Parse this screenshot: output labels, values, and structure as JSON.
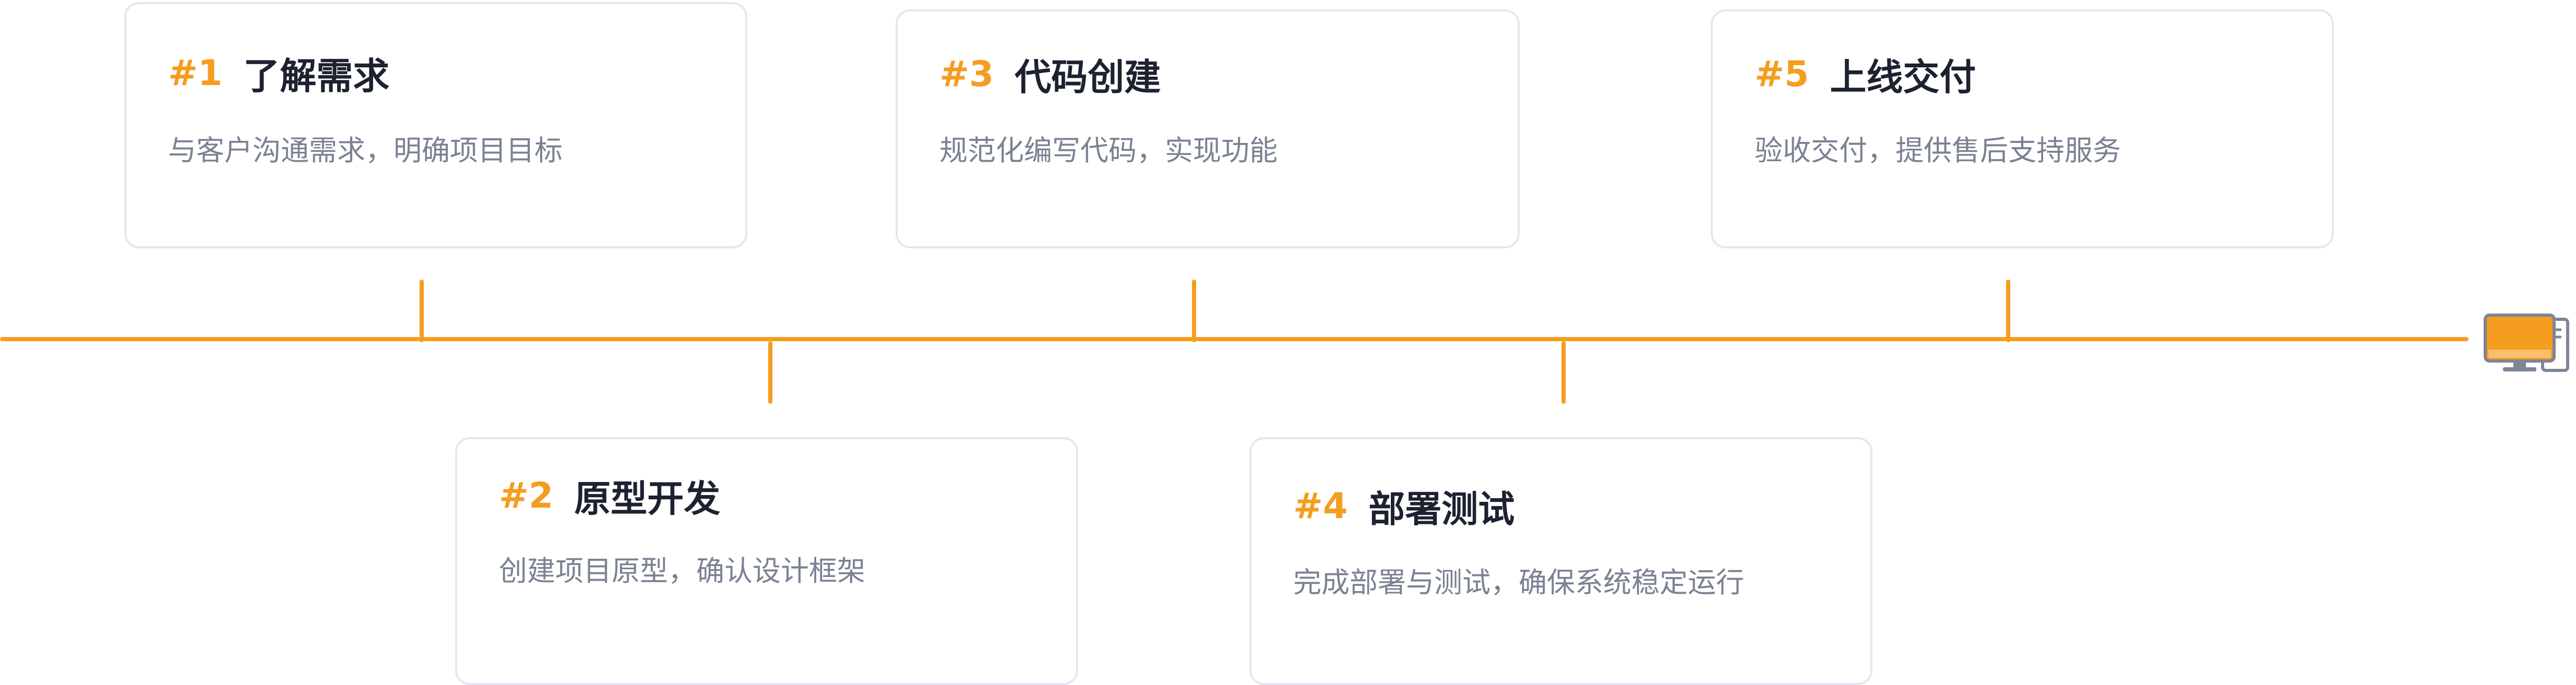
{
  "colors": {
    "accent": "#f59d1f",
    "title": "#1d2230",
    "description": "#7a8292",
    "card_border": "#e6e6f0"
  },
  "steps": [
    {
      "number": "#1",
      "title": "了解需求",
      "description": "与客户沟通需求，明确项目目标",
      "position": "above"
    },
    {
      "number": "#2",
      "title": "原型开发",
      "description": "创建项目原型，确认设计框架",
      "position": "below"
    },
    {
      "number": "#3",
      "title": "代码创建",
      "description": "规范化编写代码，实现功能",
      "position": "above"
    },
    {
      "number": "#4",
      "title": "部署测试",
      "description": "完成部署与测试，确保系统稳定运行",
      "position": "below"
    },
    {
      "number": "#5",
      "title": "上线交付",
      "description": "验收交付，提供售后支持服务",
      "position": "above"
    }
  ],
  "end_icon": "computer-icon"
}
